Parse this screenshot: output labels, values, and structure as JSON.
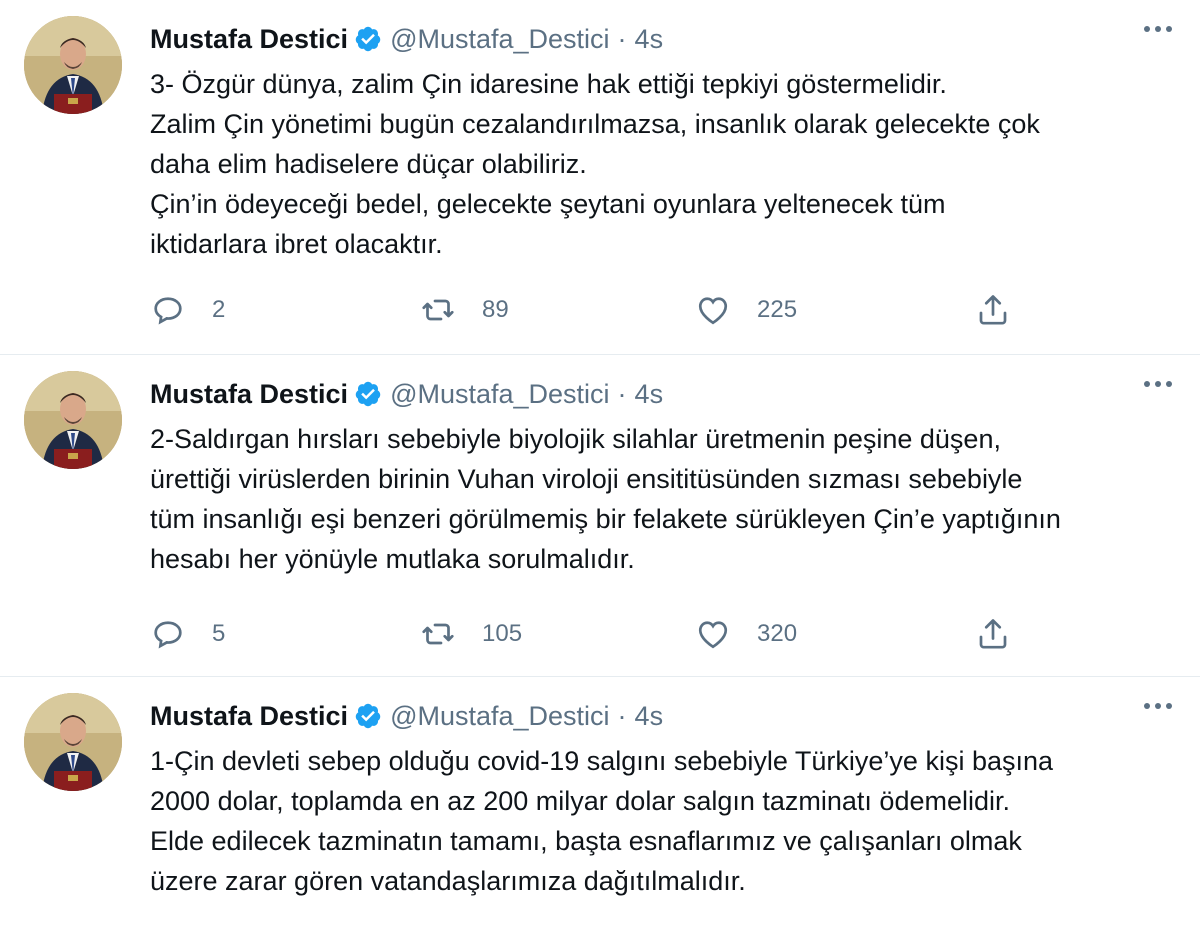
{
  "tweets": [
    {
      "name": "Mustafa Destici",
      "handle": "@Mustafa_Destici",
      "separator": "·",
      "time": "4s",
      "lines": [
        "3- Özgür dünya, zalim Çin idaresine hak ettiği tepkiyi göstermelidir.",
        "Zalim  Çin yönetimi bugün cezalandırılmazsa, insanlık olarak gelecekte çok",
        "daha elim hadiselere düçar olabiliriz.",
        "Çin’in ödeyeceği bedel, gelecekte şeytani oyunlara yeltenecek tüm",
        "iktidarlara ibret olacaktır."
      ],
      "replies": "2",
      "retweets": "89",
      "likes": "225"
    },
    {
      "name": "Mustafa Destici",
      "handle": "@Mustafa_Destici",
      "separator": "·",
      "time": "4s",
      "lines": [
        "2-Saldırgan hırsları sebebiyle biyolojik silahlar üretmenin peşine düşen,",
        "ürettiği virüslerden birinin Vuhan viroloji ensititüsünden sızması sebebiyle",
        "tüm insanlığı eşi benzeri görülmemiş bir felakete sürükleyen Çin’e yaptığının",
        "hesabı her yönüyle mutlaka sorulmalıdır."
      ],
      "replies": "5",
      "retweets": "105",
      "likes": "320"
    },
    {
      "name": "Mustafa Destici",
      "handle": "@Mustafa_Destici",
      "separator": "·",
      "time": "4s",
      "lines": [
        "1-Çin devleti sebep olduğu covid-19 salgını sebebiyle Türkiye’ye kişi başına",
        "2000 dolar, toplamda en az 200 milyar dolar salgın tazminatı ödemelidir.",
        "Elde edilecek tazminatın tamamı, başta esnaflarımız ve çalışanları olmak",
        "üzere zarar gören vatandaşlarımıza dağıtılmalıdır."
      ]
    }
  ],
  "icons": {
    "verified": "verified-badge-icon",
    "more": "more-dots-icon",
    "reply": "reply-icon",
    "retweet": "retweet-icon",
    "like": "heart-icon",
    "share": "share-icon"
  },
  "colors": {
    "verified": "#1da1f2",
    "secondary_text": "#5b7083",
    "divider": "#e6ecf0"
  }
}
